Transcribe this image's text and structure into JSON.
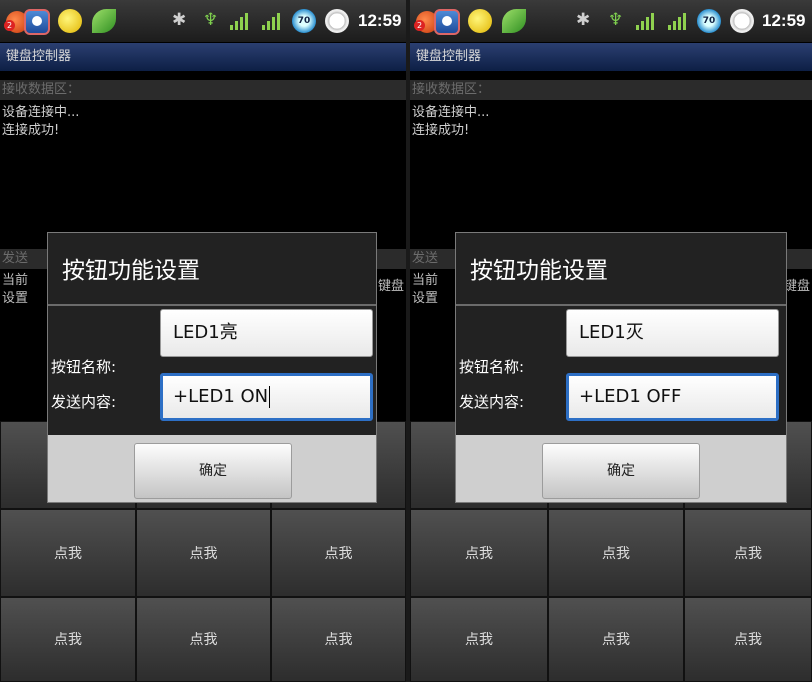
{
  "status": {
    "time": "12:59",
    "badge": "2",
    "battery_level": "70"
  },
  "app_title": "键盘控制器",
  "receive_header": "接收数据区：",
  "log_lines": [
    "设备连接中...",
    "连接成功!"
  ],
  "send_header": "发送",
  "current_prefix": "当前",
  "setting_prefix": "设置",
  "keyboard_suffix": "键盘",
  "key_label": "点我",
  "screens": [
    {
      "dialog": {
        "title": "按钮功能设置",
        "name_label": "按钮名称:",
        "name_value": "LED1亮",
        "content_label": "发送内容:",
        "content_value": "+LED1 ON",
        "confirm": "确定"
      }
    },
    {
      "dialog": {
        "title": "按钮功能设置",
        "name_label": "按钮名称:",
        "name_value": "LED1灭",
        "content_label": "发送内容:",
        "content_value": "+LED1 OFF",
        "confirm": "确定"
      }
    }
  ],
  "icons": [
    "notification-app-icon",
    "media-player-icon",
    "lemon-icon",
    "leaf-icon",
    "bluetooth-icon",
    "usb-icon",
    "3g-signal-icon",
    "cell-signal-icon",
    "battery-70-icon",
    "alarm-clock-icon"
  ]
}
